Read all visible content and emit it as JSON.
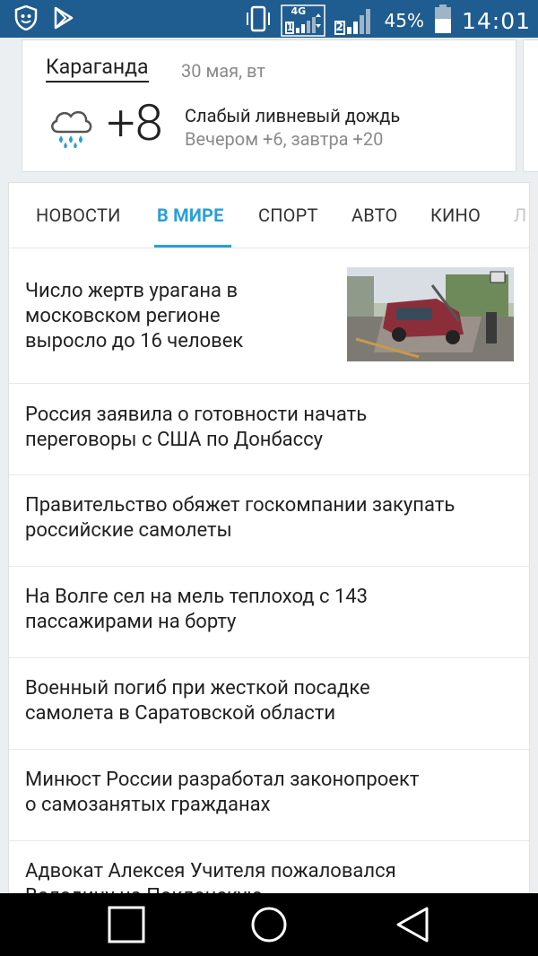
{
  "status_bar": {
    "time": "14:01",
    "battery_percent": "45%",
    "network_type": "4G",
    "sim1": "1",
    "sim2": "2",
    "left_icons": [
      "shield-app-icon",
      "play-store-icon"
    ]
  },
  "weather": {
    "city": "Караганда",
    "date": "30 мая, вт",
    "temperature": "+8",
    "condition": "Слабый ливневый дождь",
    "forecast": "Вечером +6, завтра +20",
    "icon": "rain-cloud-icon"
  },
  "tabs": [
    {
      "label": "НОВОСТИ",
      "active": false
    },
    {
      "label": "В МИРЕ",
      "active": true
    },
    {
      "label": "СПОРТ",
      "active": false
    },
    {
      "label": "АВТО",
      "active": false
    },
    {
      "label": "КИНО",
      "active": false
    },
    {
      "label": "Л",
      "active": false
    }
  ],
  "news": [
    {
      "title_line1": "Число жертв урагана в",
      "title_line2": "московском регионе",
      "title_line3": "выросло до 16 человек"
    },
    {
      "title_line1": "Россия заявила о готовности начать",
      "title_line2": "переговоры с США по Донбассу"
    },
    {
      "title_line1": "Правительство обяжет госкомпании закупать",
      "title_line2": "российские самолеты"
    },
    {
      "title_line1": "На Волге сел на мель теплоход с 143",
      "title_line2": "пассажирами на борту"
    },
    {
      "title_line1": "Военный погиб при жесткой посадке",
      "title_line2": "самолета в Саратовской области"
    },
    {
      "title_line1": "Минюст России разработал законопроект",
      "title_line2": "о самозанятых гражданах"
    },
    {
      "title_line1": "Адвокат Алексея Учителя пожаловался",
      "title_line2": "Володину на Поклонскую"
    }
  ],
  "colors": {
    "status_bar": "#1f5c8f",
    "accent": "#2a9fd8",
    "background": "#eceff1"
  }
}
